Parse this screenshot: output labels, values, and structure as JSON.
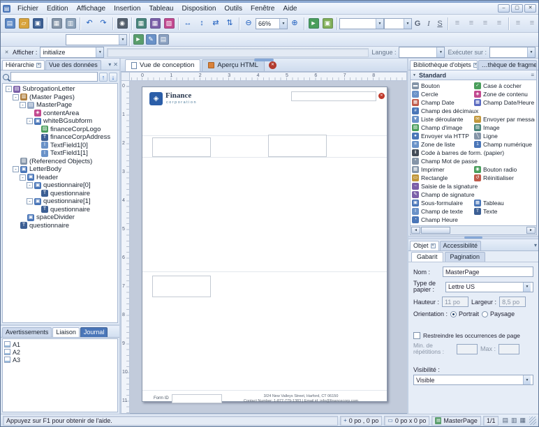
{
  "window": {
    "minimize_glyph": "–",
    "restore_glyph": "▢",
    "close_glyph": "✕",
    "app_glyph": "▤"
  },
  "menu": {
    "items": [
      {
        "label": "Fichier",
        "name": "menu-fichier"
      },
      {
        "label": "Edition",
        "name": "menu-edition"
      },
      {
        "label": "Affichage",
        "name": "menu-affichage"
      },
      {
        "label": "Insertion",
        "name": "menu-insertion"
      },
      {
        "label": "Tableau",
        "name": "menu-tableau"
      },
      {
        "label": "Disposition",
        "name": "menu-disposition"
      },
      {
        "label": "Outils",
        "name": "menu-outils"
      },
      {
        "label": "Fenêtre",
        "name": "menu-fenetre"
      },
      {
        "label": "Aide",
        "name": "menu-aide"
      }
    ]
  },
  "toolbar": {
    "zoom_value": "66%",
    "bold_label": "G",
    "italic_label": "I",
    "underline_label": "S",
    "row1": [
      "new",
      "open",
      "save",
      "sep",
      "print",
      "preview",
      "sep",
      "undo",
      "redo",
      "sep",
      "find",
      "sep",
      "insert-table",
      "grid",
      "palette",
      "sep",
      "distribute-h",
      "distribute-v",
      "swap-h",
      "swap-v",
      "sep",
      "zoom-out",
      "zoom-combo",
      "zoom-in",
      "sep",
      "pdf-preview",
      "package",
      "sep",
      "spring",
      "font-combo",
      "size-combo",
      "bold",
      "italic",
      "underline",
      "sep",
      "align-left",
      "align-center",
      "align-right",
      "align-justify",
      "sep",
      "valign-top",
      "valign-bottom"
    ],
    "row2": [
      "style-combo",
      "sep",
      "page-green-arrow",
      "page-pencil",
      "page-blue"
    ]
  },
  "script_bar": {
    "afficher_label": "Afficher :",
    "afficher_value": "initialize",
    "langue_label": "Langue :",
    "executer_label": "Exécuter sur :"
  },
  "left_panel": {
    "tabs": [
      {
        "label": "Hiérarchie",
        "name": "tab-hierarchie"
      },
      {
        "label": "Vue des données",
        "name": "tab-vue-des-donnees"
      }
    ],
    "search_placeholder": "",
    "tree": [
      {
        "label": "SubrogationLetter",
        "level": 0,
        "exp": true,
        "icon": "form"
      },
      {
        "label": "(Master Pages)",
        "level": 1,
        "exp": true,
        "icon": "master-pages"
      },
      {
        "label": "MasterPage",
        "level": 2,
        "exp": true,
        "icon": "master-page"
      },
      {
        "label": "contentArea",
        "level": 3,
        "exp": false,
        "icon": "content-area"
      },
      {
        "label": "whiteBGsubform",
        "level": 3,
        "exp": true,
        "icon": "subform"
      },
      {
        "label": "financeCorpLogo",
        "level": 4,
        "exp": false,
        "icon": "image"
      },
      {
        "label": "financeCorpAddress",
        "level": 4,
        "exp": false,
        "icon": "text"
      },
      {
        "label": "TextField1[0]",
        "level": 4,
        "exp": false,
        "icon": "text-field"
      },
      {
        "label": "TextField1[1]",
        "level": 4,
        "exp": false,
        "icon": "text-field"
      },
      {
        "label": "(Referenced Objects)",
        "level": 1,
        "exp": false,
        "icon": "referenced-objects"
      },
      {
        "label": "LetterBody",
        "level": 1,
        "exp": true,
        "icon": "subform"
      },
      {
        "label": "Header",
        "level": 2,
        "exp": true,
        "icon": "subform"
      },
      {
        "label": "questionnaire[0]",
        "level": 3,
        "exp": true,
        "icon": "subform"
      },
      {
        "label": "questionnaire",
        "level": 4,
        "exp": false,
        "icon": "text"
      },
      {
        "label": "questionnaire[1]",
        "level": 3,
        "exp": true,
        "icon": "subform"
      },
      {
        "label": "questionnaire",
        "level": 4,
        "exp": false,
        "icon": "text"
      },
      {
        "label": "spaceDivider",
        "level": 2,
        "exp": false,
        "icon": "subform"
      },
      {
        "label": "questionnaire",
        "level": 1,
        "exp": false,
        "icon": "text"
      }
    ]
  },
  "report_panel": {
    "tabs": [
      {
        "label": "Avertissements",
        "name": "tab-avertissements",
        "style": "plain"
      },
      {
        "label": "Liaison",
        "name": "tab-liaison",
        "style": "white"
      },
      {
        "label": "Journal",
        "name": "tab-journal",
        "style": "blue"
      }
    ],
    "items": [
      {
        "label": "A1"
      },
      {
        "label": "A2"
      },
      {
        "label": "A3"
      }
    ]
  },
  "design_area": {
    "tabs": [
      {
        "label": "Vue de conception",
        "name": "tab-vue-de-conception"
      },
      {
        "label": "Aperçu HTML",
        "name": "tab-apercu-html"
      }
    ],
    "rulers": {
      "horizontal": [
        "0",
        "1",
        "2",
        "3",
        "4",
        "5",
        "6",
        "7",
        "8"
      ],
      "vertical": [
        "0",
        "1",
        "2",
        "3",
        "4",
        "5",
        "6",
        "7",
        "8",
        "9",
        "10",
        "11"
      ]
    }
  },
  "canvas": {
    "logo_title": "Finance",
    "logo_subtitle": "corporation",
    "form_id_label": "Form ID",
    "address_line1": "3/24 New Valleys Street, Harford, CT 06150",
    "address_line2": "Contact Number: 1-877-779-1383 | Email id: info@financecorp.com"
  },
  "library": {
    "tabs": [
      {
        "label": "Bibliothèque d'objets",
        "name": "tab-bibliotheque-objets"
      },
      {
        "label": "…thèque de fragme",
        "name": "tab-bibliotheque-fragments"
      }
    ],
    "category": "Standard",
    "items": [
      {
        "label": "Bouton",
        "icon": "button",
        "span": 1
      },
      {
        "label": "Case à cocher",
        "icon": "checkbox",
        "span": 1
      },
      {
        "label": "Cercle",
        "icon": "circle",
        "span": 1
      },
      {
        "label": "Zone de contenu",
        "icon": "content-area",
        "span": 1
      },
      {
        "label": "Champ Date",
        "icon": "date-field",
        "span": 1
      },
      {
        "label": "Champ Date/Heure",
        "icon": "datetime-field",
        "span": 1
      },
      {
        "label": "Champ des décimaux",
        "icon": "decimal-field",
        "span": 2
      },
      {
        "label": "Liste déroulante",
        "icon": "dropdown",
        "span": 1
      },
      {
        "label": "Envoyer par message",
        "icon": "email-submit",
        "span": 1
      },
      {
        "label": "Champ d'image",
        "icon": "image-field",
        "span": 1
      },
      {
        "label": "Image",
        "icon": "image",
        "span": 1
      },
      {
        "label": "Envoyer via HTTP",
        "icon": "http-submit",
        "span": 1
      },
      {
        "label": "Ligne",
        "icon": "line",
        "span": 1
      },
      {
        "label": "Zone de liste",
        "icon": "list-box",
        "span": 1
      },
      {
        "label": "Champ numérique",
        "icon": "numeric-field",
        "span": 1
      },
      {
        "label": "Code à barres de form. (papier)",
        "icon": "barcode",
        "span": 2
      },
      {
        "label": "Champ Mot de passe",
        "icon": "password-field",
        "span": 2
      },
      {
        "label": "Imprimer",
        "icon": "print-button",
        "span": 1
      },
      {
        "label": "Bouton radio",
        "icon": "radio-button",
        "span": 1
      },
      {
        "label": "Rectangle",
        "icon": "rectangle",
        "span": 1
      },
      {
        "label": "Réinitialiser",
        "icon": "reset-button",
        "span": 1
      },
      {
        "label": "Saisie de la signature",
        "icon": "signature-scribble",
        "span": 2
      },
      {
        "label": "Champ de signature",
        "icon": "signature-field",
        "span": 2
      },
      {
        "label": "Sous-formulaire",
        "icon": "subform",
        "span": 1
      },
      {
        "label": "Tableau",
        "icon": "table",
        "span": 1
      },
      {
        "label": "Champ de texte",
        "icon": "text-field",
        "span": 1
      },
      {
        "label": "Texte",
        "icon": "text",
        "span": 1
      },
      {
        "label": "Champ Heure",
        "icon": "time-field",
        "span": 1
      }
    ]
  },
  "object_panel": {
    "tabs": [
      {
        "label": "Objet",
        "name": "tab-objet"
      },
      {
        "label": "Accessibilité",
        "name": "tab-accessibilite"
      }
    ],
    "subtabs": [
      {
        "label": "Gabarit",
        "name": "subtab-gabarit"
      },
      {
        "label": "Pagination",
        "name": "subtab-pagination"
      }
    ],
    "fields": {
      "nom_label": "Nom :",
      "nom_value": "MasterPage",
      "papier_label": "Type de papier :",
      "papier_value": "Lettre US",
      "hauteur_label": "Hauteur :",
      "hauteur_value": "11 po",
      "largeur_label": "Largeur :",
      "largeur_value": "8,5 po",
      "orientation_label": "Orientation :",
      "portrait_label": "Portrait",
      "paysage_label": "Paysage",
      "restreindre_label": "Restreindre les occurrences de page",
      "min_label": "Min. de répétitions :",
      "max_label": "Max :",
      "visibilite_label": "Visibilité :",
      "visibilite_value": "Visible"
    }
  },
  "status_bar": {
    "help_text": "Appuyez sur F1 pour obtenir de l'aide.",
    "cursor_position": "0 po , 0 po",
    "selection_size": "0 po x 0 po",
    "active_master_page": "MasterPage",
    "page_indicator": "1/1"
  }
}
